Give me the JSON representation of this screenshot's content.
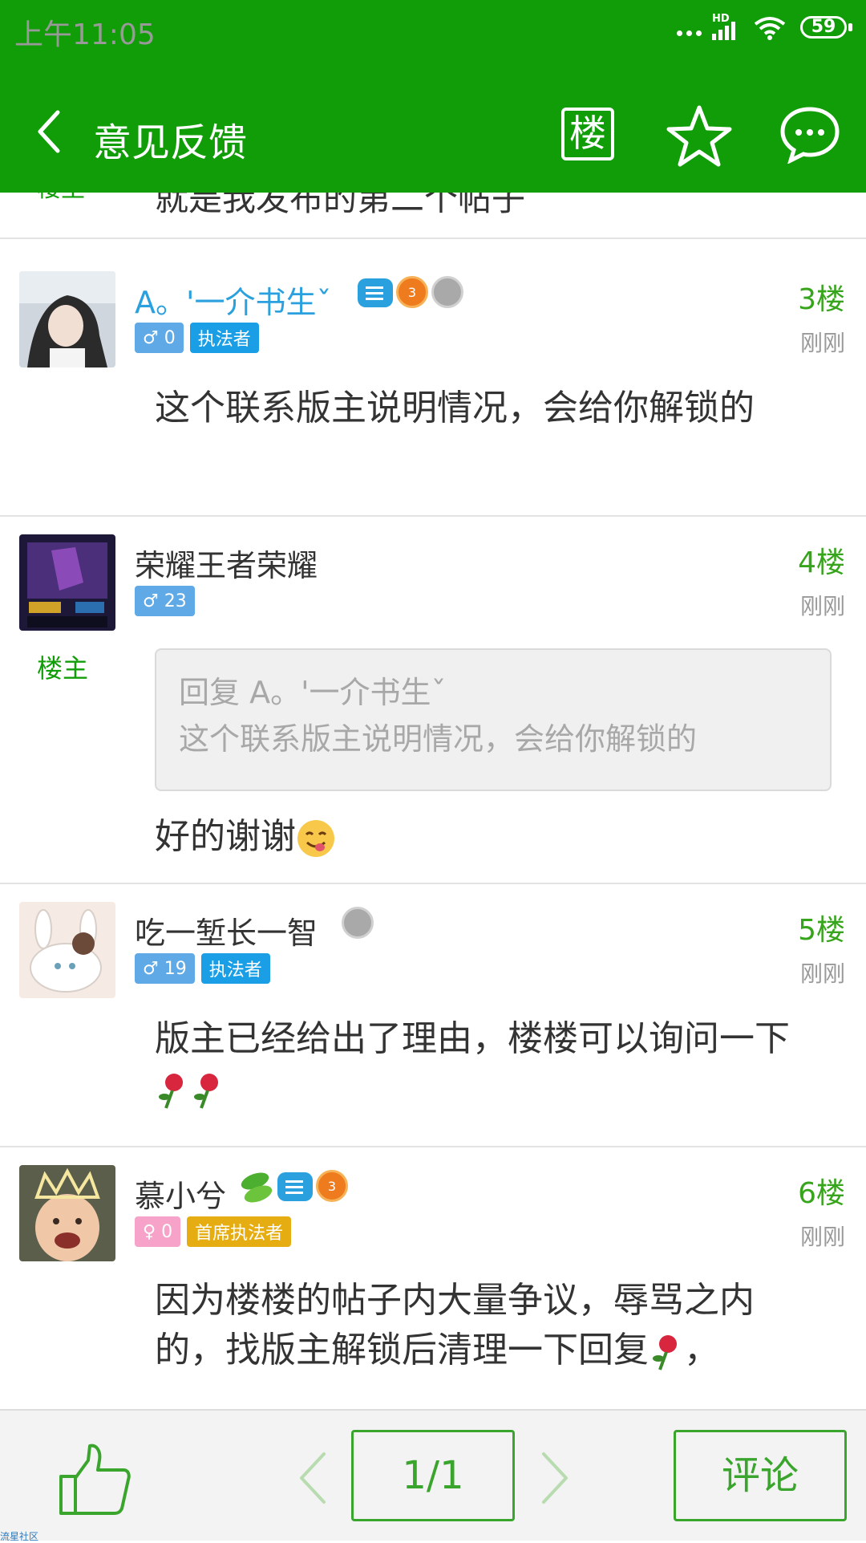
{
  "status_bar": {
    "time": "上午11:05",
    "network": "HD",
    "battery": "59"
  },
  "nav": {
    "title": "意见反馈",
    "floor_icon_label": "楼"
  },
  "previous_post": {
    "owner_tag": "楼主",
    "text": "就是我发布的第二个帖子"
  },
  "posts": [
    {
      "username": "A。'一介书生ˇ",
      "gender_level": "♂ 0",
      "role": "执法者",
      "floor": "3楼",
      "time": "刚刚",
      "badges": [
        "chat-badge",
        "level-3-badge",
        "silver-medal-badge"
      ],
      "body": "这个联系版主说明情况，会给你解锁的"
    },
    {
      "username": "荣耀王者荣耀",
      "gender_level": "♂ 23",
      "owner_tag": "楼主",
      "floor": "4楼",
      "time": "刚刚",
      "quote_author": "回复 A。'一介书生ˇ",
      "quote_text": "这个联系版主说明情况，会给你解锁的",
      "body": "好的谢谢"
    },
    {
      "username": "吃一堑长一智",
      "gender_level": "♂ 19",
      "role": "执法者",
      "floor": "5楼",
      "time": "刚刚",
      "badges": [
        "silver-medal-badge"
      ],
      "body": "版主已经给出了理由，楼楼可以询问一下"
    },
    {
      "username": "慕小兮",
      "gender_level": "♀ 0",
      "role": "首席执法者",
      "floor": "6楼",
      "time": "刚刚",
      "badges": [
        "leaf-badge",
        "chat-badge",
        "level-3-badge"
      ],
      "body": "因为楼楼的帖子内大量争议，辱骂之内的，找版主解锁后清理一下回复",
      "body_tail": "，"
    }
  ],
  "bottom": {
    "page": "1/1",
    "comment": "评论",
    "watermark": "流星社区"
  },
  "colors": {
    "primary": "#109d08",
    "accent_green": "#3aa52c",
    "link_blue": "#2aa0de"
  }
}
